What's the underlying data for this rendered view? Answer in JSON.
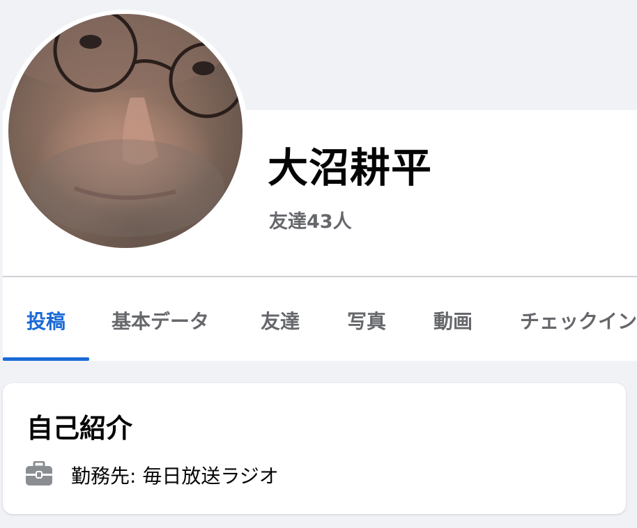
{
  "profile": {
    "name": "大沼耕平",
    "friends_count_text": "友達43人"
  },
  "tabs": [
    {
      "label": "投稿",
      "active": true
    },
    {
      "label": "基本データ",
      "active": false
    },
    {
      "label": "友達",
      "active": false
    },
    {
      "label": "写真",
      "active": false
    },
    {
      "label": "動画",
      "active": false
    },
    {
      "label": "チェックイン",
      "active": false
    }
  ],
  "intro": {
    "title": "自己紹介",
    "work_text": "勤務先: 毎日放送ラジオ",
    "work_icon": "briefcase-icon"
  },
  "colors": {
    "accent": "#1b6ad6",
    "secondary_text": "#65676b",
    "background": "#f0f2f5"
  }
}
